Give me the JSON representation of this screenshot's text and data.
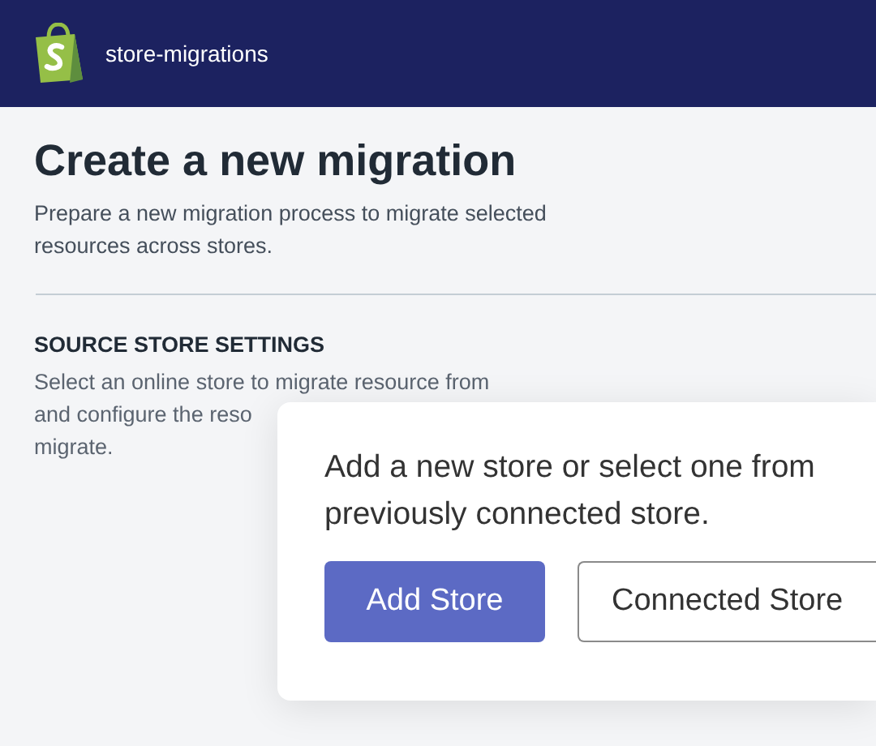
{
  "header": {
    "app_name": "store-migrations"
  },
  "page": {
    "title": "Create a new migration",
    "subtitle_lines": [
      "Prepare a new migration process to migrate selected",
      "resources across stores."
    ]
  },
  "section": {
    "heading": "SOURCE STORE SETTINGS",
    "description_lines": [
      "Select an online store to migrate resource from",
      "and configure the reso",
      "migrate."
    ]
  },
  "popover": {
    "message_lines": [
      "Add a new store or select one from",
      "previously connected store."
    ],
    "buttons": [
      {
        "label": "Add Store",
        "kind": "primary"
      },
      {
        "label": "Connected Store",
        "kind": "secondary"
      }
    ]
  }
}
